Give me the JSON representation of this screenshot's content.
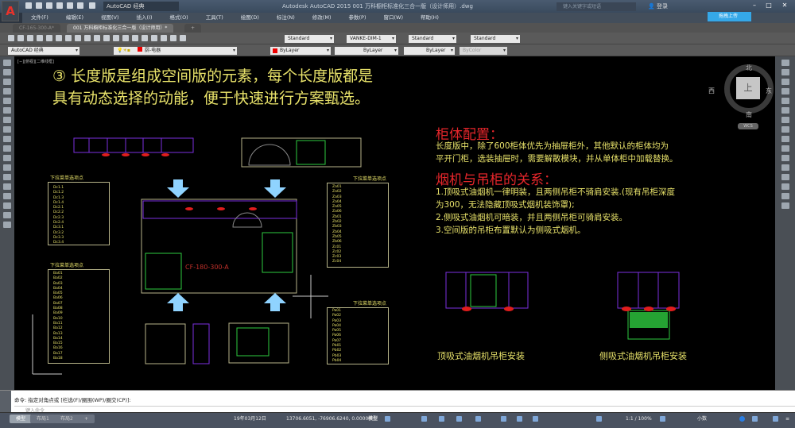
{
  "titlebar": {
    "workspace": "AutoCAD 经典",
    "app_title": "Autodesk AutoCAD 2015    001 万科橱柜标准化三合一版（设计师用）.dwg",
    "search_placeholder": "键入关键字或短语",
    "signin": "登录",
    "upload": "拖拽上传"
  },
  "menu": [
    "文件(F)",
    "编辑(E)",
    "视图(V)",
    "插入(I)",
    "格式(O)",
    "工具(T)",
    "绘图(D)",
    "标注(N)",
    "修改(M)",
    "参数(P)",
    "窗口(W)",
    "帮助(H)"
  ],
  "doc_tabs": [
    {
      "label": "CF-165-300-A*",
      "active": false
    },
    {
      "label": "001 万科橱柜标准化三合一版（设计师用）*",
      "active": true
    }
  ],
  "toolbar": {
    "text_style": "Standard",
    "dim_style": "VANKE-DIM-1",
    "table_style": "Standard",
    "mleader_style": "Standard",
    "workspace": "AutoCAD 经典",
    "layer": "厨-电器",
    "color": "ByLayer",
    "linetype": "ByLayer",
    "lineweight": "ByLayer",
    "plotstyle": "ByColor"
  },
  "viewport": {
    "label": "[−][俯视][二维线框]"
  },
  "viewcube": {
    "north": "北",
    "south": "南",
    "east": "东",
    "west": "西",
    "top": "上",
    "wcs": "WCS"
  },
  "drawing": {
    "heading_line1": "③ 长度版是组成空间版的元素，每个长度版都是",
    "heading_line2": "具有动态选择的动能，便于快速进行方案甄选。",
    "section1_title": "柜体配置：",
    "section1_text": [
      "长度版中，除了600柜体优先为抽屉柜外，其他默认的柜体均为",
      "平开门柜，选装抽屉时，需要解散模块，并从单体柜中加载替换。"
    ],
    "section2_title": "烟机与吊柜的关系：",
    "section2_text": [
      "1.顶吸式油烟机一律明装，且两侧吊柜不骑肩安装.(现有吊柜深度",
      "为300，无法隐藏顶吸式烟机装饰罩);",
      "2.侧吸式油烟机可暗装，并且两侧吊柜可骑肩安装。",
      "3.空间版的吊柜布置默认为侧吸式烟机。"
    ],
    "caption_top": "顶吸式油烟机吊柜安装",
    "caption_side": "侧吸式油烟机吊柜安装",
    "plan_label": "CF-180-300-A",
    "list_header": "下拉菜单选项点",
    "list1": [
      "Dc1.1",
      "Dc1.2",
      "Dc1.3",
      "Dc1.4",
      "Dc2.1",
      "Dc2.2",
      "Dc2.3",
      "Dc2.4",
      "Dc3.1",
      "Dc3.2",
      "Dc3.3",
      "Dc3.4"
    ],
    "list2": [
      "Ba01",
      "Ba02",
      "Ba03",
      "Ba04",
      "Ba05",
      "Ba06",
      "Ba07",
      "Ba08",
      "Ba09",
      "Ba10",
      "Ba11",
      "Ba12",
      "Ba13",
      "Ba14",
      "Ba15",
      "Ba16",
      "Ba17",
      "Ba18"
    ],
    "list3": [
      "Za01",
      "Za02",
      "Za03",
      "Za04",
      "Za05",
      "Za06",
      "Zb01",
      "Zb02",
      "Zb03",
      "Zb04",
      "Zb05",
      "Zb06",
      "Zc01",
      "Zc02",
      "Zc03",
      "Zc04"
    ],
    "list4": [
      "Pa01",
      "Pa02",
      "Pa03",
      "Pa04",
      "Pa05",
      "Pa06",
      "Pa07",
      "Pb01",
      "Pb02",
      "Pb03",
      "Pb04"
    ]
  },
  "command": {
    "history": "命令: 指定对角点或 [栏选(F)/圈围(WP)/圈交(CP)]:",
    "placeholder": "键入命令"
  },
  "layout_tabs": [
    "模型",
    "布局1",
    "布局2",
    "+"
  ],
  "status": {
    "date": "19年03月12日",
    "coords": "13706.6051, -76906.6240, 0.0000",
    "space": "模型",
    "scale": "1:1 / 100%",
    "units": "小数"
  }
}
